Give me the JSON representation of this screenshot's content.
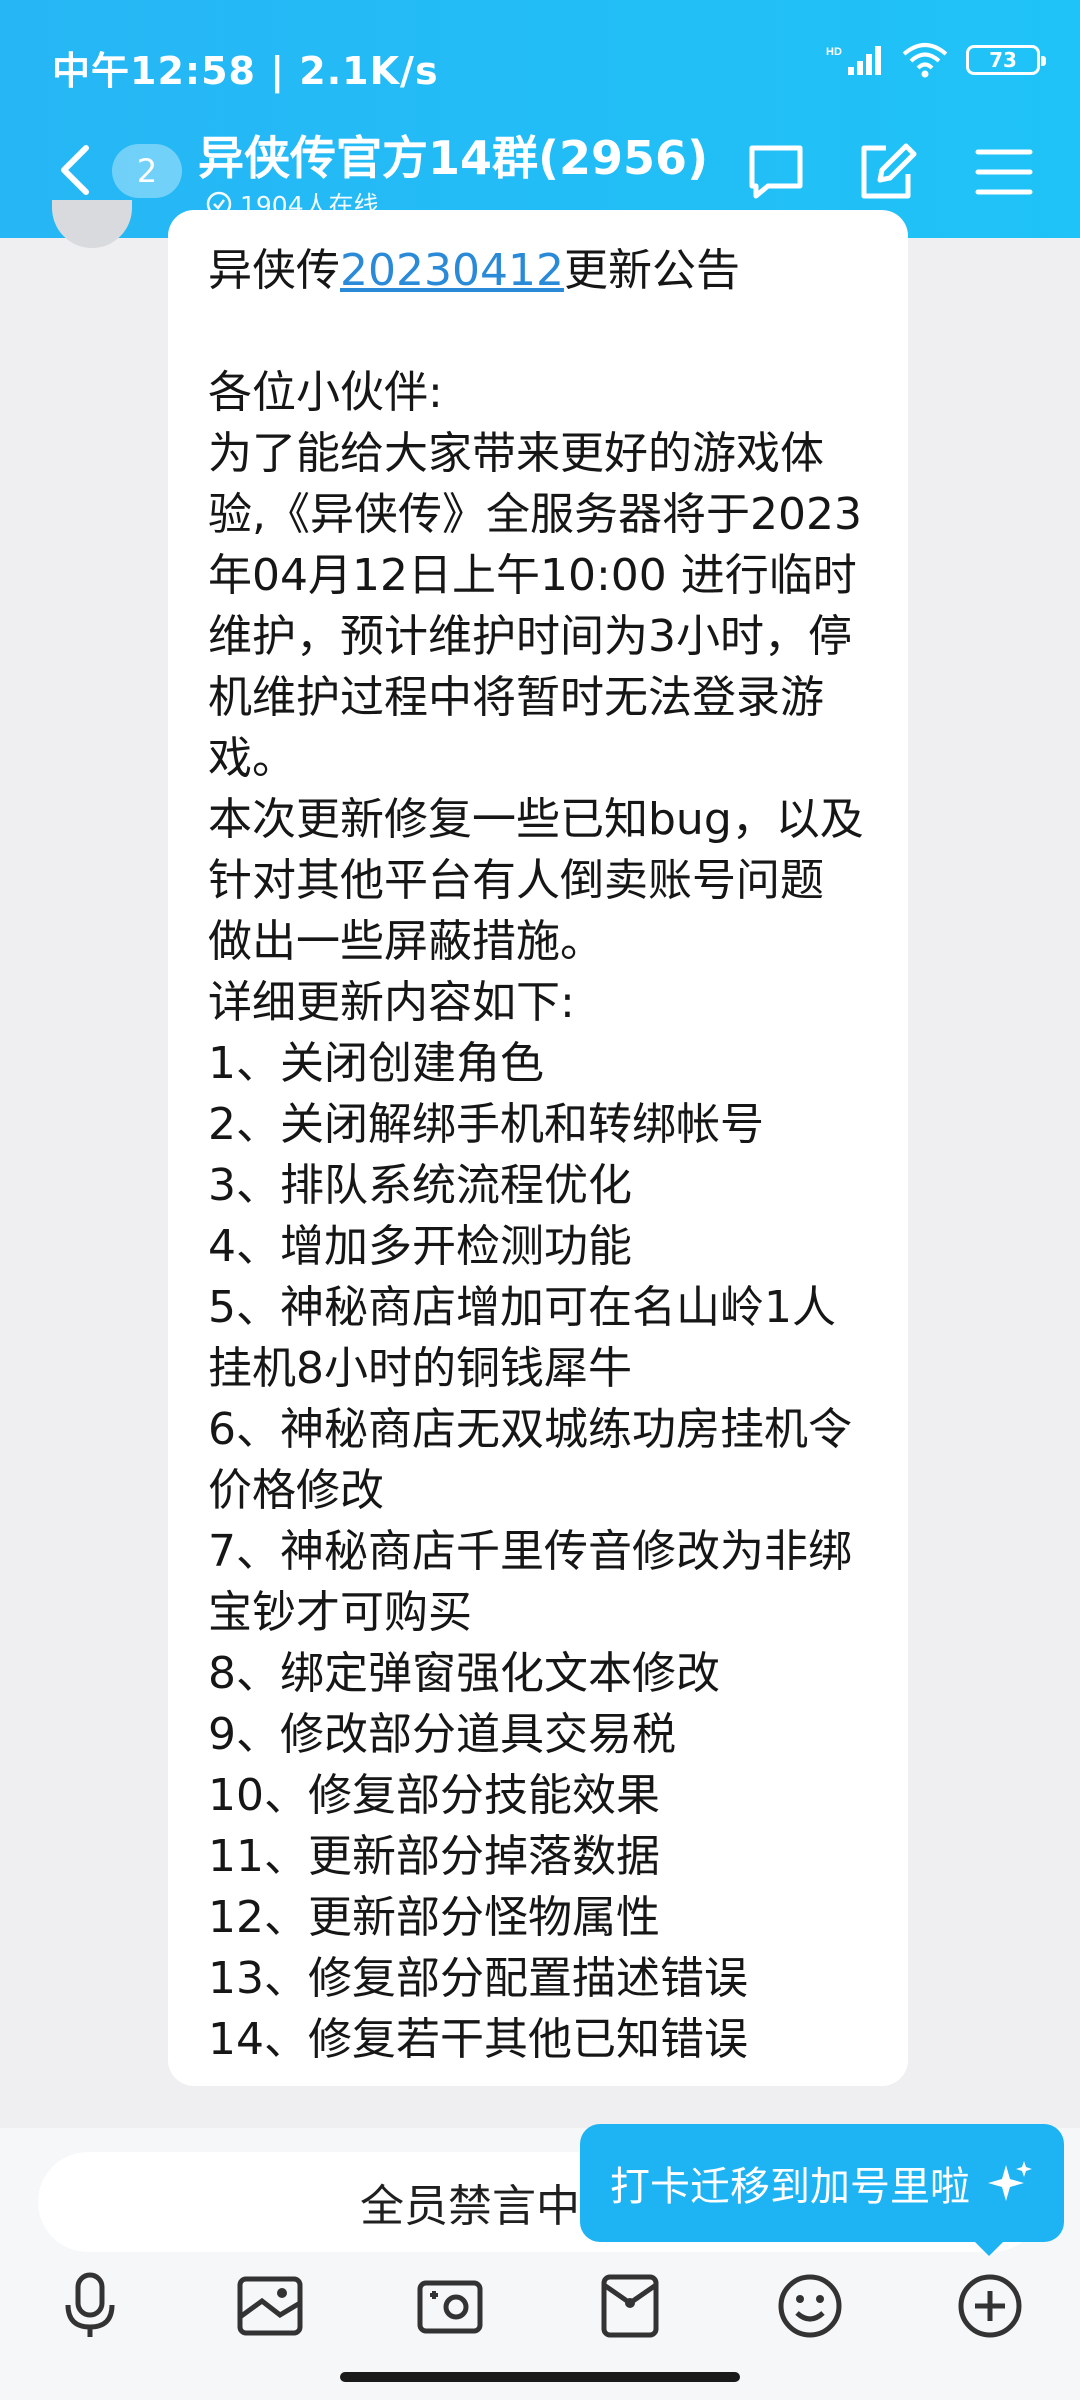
{
  "status_bar": {
    "time": "中午12:58 | 2.1K/s",
    "hd": "HD",
    "battery": "73"
  },
  "header": {
    "unread_count": "2",
    "title": "异侠传官方14群(2956)",
    "online": "1904人在线"
  },
  "message": {
    "lines": [
      {
        "pre": "异侠传",
        "link": "20230412",
        "post": "更新公告"
      },
      {
        "text": ""
      },
      {
        "text": "各位小伙伴:"
      },
      {
        "text": "为了能给大家带来更好的游戏体"
      },
      {
        "text": "验,《异侠传》全服务器将于2023"
      },
      {
        "text": "年04月12日上午10:00 进行临时"
      },
      {
        "text": "维护，预计维护时间为3小时，停"
      },
      {
        "text": "机维护过程中将暂时无法登录游"
      },
      {
        "text": "戏。"
      },
      {
        "text": "本次更新修复一些已知bug，以及"
      },
      {
        "text": "针对其他平台有人倒卖账号问题"
      },
      {
        "text": "做出一些屏蔽措施。"
      },
      {
        "text": "详细更新内容如下:"
      },
      {
        "text": "1、关闭创建角色"
      },
      {
        "text": "2、关闭解绑手机和转绑帐号"
      },
      {
        "text": "3、排队系统流程优化"
      },
      {
        "text": "4、增加多开检测功能"
      },
      {
        "text": "5、神秘商店增加可在名山岭1人"
      },
      {
        "text": "挂机8小时的铜钱犀牛"
      },
      {
        "text": "6、神秘商店无双城练功房挂机令"
      },
      {
        "text": "价格修改"
      },
      {
        "text": "7、神秘商店千里传音修改为非绑"
      },
      {
        "text": "宝钞才可购买"
      },
      {
        "text": "8、绑定弹窗强化文本修改"
      },
      {
        "text": "9、修改部分道具交易税"
      },
      {
        "text": "10、修复部分技能效果"
      },
      {
        "text": "11、更新部分掉落数据"
      },
      {
        "text": "12、更新部分怪物属性"
      },
      {
        "text": "13、修复部分配置描述错误"
      },
      {
        "text": "14、修复若干其他已知错误"
      }
    ]
  },
  "input": {
    "muted_text": "全员禁言中"
  },
  "tip": {
    "text": "打卡迁移到加号里啦"
  },
  "colors": {
    "accent": "#1fb8f5",
    "link": "#2a8ad8",
    "background": "#efeff1"
  }
}
